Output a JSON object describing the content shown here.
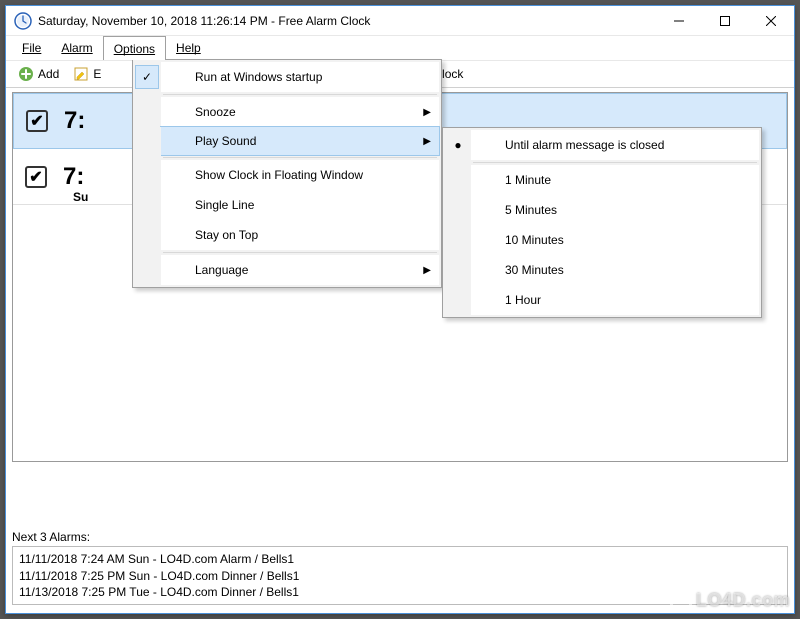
{
  "title": "Saturday, November 10, 2018 11:26:14 PM - Free Alarm Clock",
  "menubar": {
    "file": "File",
    "alarm": "Alarm",
    "options": "Options",
    "help": "Help"
  },
  "toolbar": {
    "add": "Add",
    "edit_partial": "E",
    "hot_clock": "Hot Alarm Clock"
  },
  "options_menu": {
    "run_startup": "Run at Windows startup",
    "snooze": "Snooze",
    "play_sound": "Play Sound",
    "floating": "Show Clock in Floating Window",
    "single_line": "Single Line",
    "stay_top": "Stay on Top",
    "language": "Language"
  },
  "play_sound_submenu": {
    "until_closed": "Until alarm message is closed",
    "m1": "1 Minute",
    "m5": "5 Minutes",
    "m10": "10 Minutes",
    "m30": "30 Minutes",
    "h1": "1 Hour"
  },
  "alarms": {
    "row0_time": "7:",
    "row1_time": "7:",
    "row1_sub": "Su"
  },
  "next_alarms": {
    "label": "Next 3 Alarms:",
    "line1": "11/11/2018 7:24 AM Sun - LO4D.com Alarm / Bells1",
    "line2": "11/11/2018 7:25 PM Sun - LO4D.com Dinner / Bells1",
    "line3": "11/13/2018 7:25 PM Tue - LO4D.com Dinner / Bells1"
  },
  "watermark": "LO4D.com"
}
